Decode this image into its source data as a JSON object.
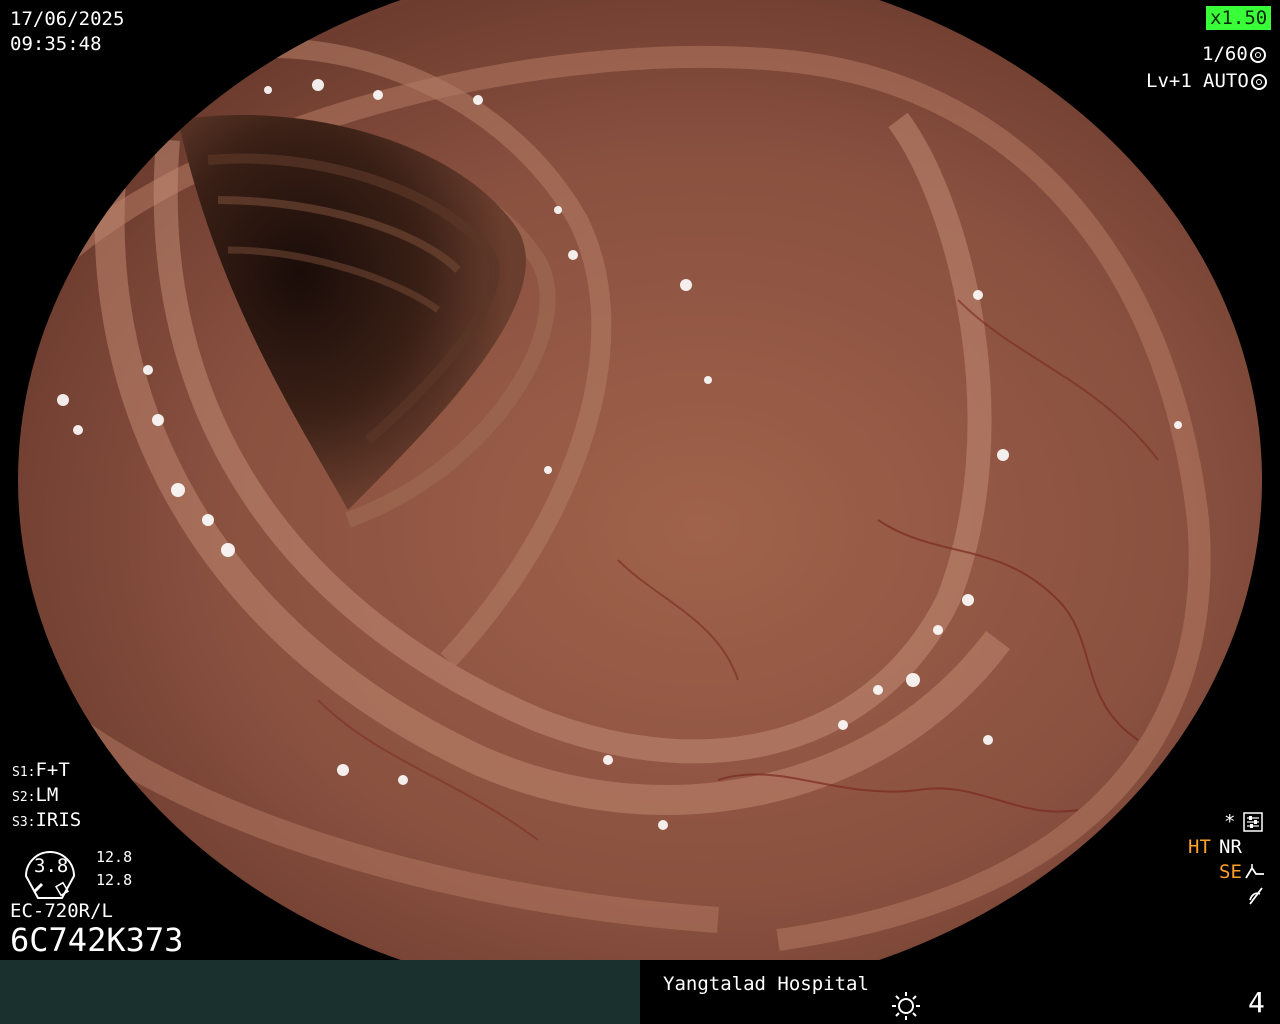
{
  "top_left": {
    "date": "17/06/2025",
    "time": "09:35:48"
  },
  "top_right": {
    "zoom": "x1.50",
    "shutter": "1/60",
    "level": "Lv+1",
    "iris_mode": "AUTO",
    "zoom_badge_color": "#38ff38"
  },
  "switches": [
    {
      "key": "S1",
      "value": "F+T"
    },
    {
      "key": "S2",
      "value": "LM"
    },
    {
      "key": "S3",
      "value": "IRIS"
    }
  ],
  "gauge": {
    "value": "3.8",
    "right_top": "12.8",
    "right_bottom": "12.8"
  },
  "scope": {
    "model": "EC-720R/L",
    "serial": "6C742K373"
  },
  "right_indicators": {
    "asterisk": "*",
    "ht": "HT",
    "nr": "NR",
    "se": "SE",
    "ht_color": "#ffa028",
    "se_color": "#ffa028"
  },
  "bottom_bar": {
    "hospital": "Yangtalad Hospital",
    "page_number": "4",
    "left_color": "#19302f"
  }
}
